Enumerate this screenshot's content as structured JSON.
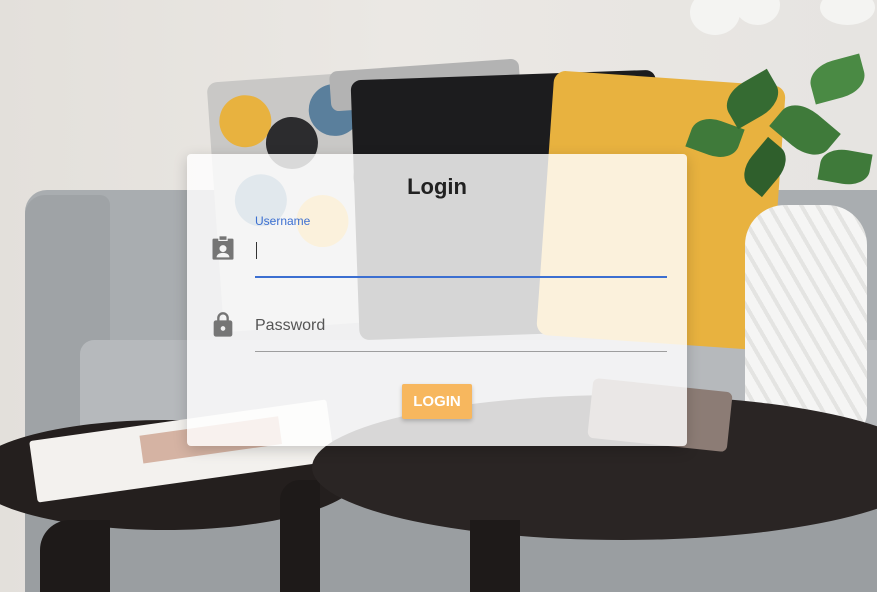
{
  "login_form": {
    "title": "Login",
    "username": {
      "label": "Username",
      "value": "",
      "icon": "contact-badge-icon"
    },
    "password": {
      "placeholder": "Password",
      "value": "",
      "icon": "lock-icon"
    },
    "submit_label": "LOGIN"
  },
  "colors": {
    "accent_blue": "#3c6fd1",
    "button_orange": "#f7b75e",
    "icon_gray": "#757575"
  }
}
